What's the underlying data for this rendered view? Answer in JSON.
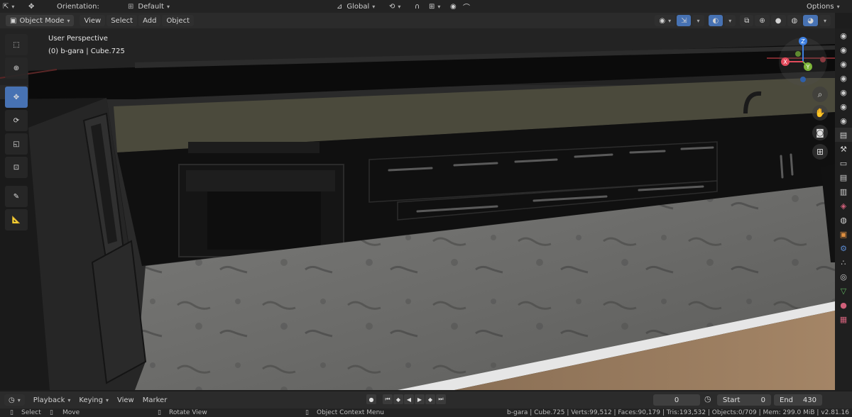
{
  "header": {
    "orientation_label": "Orientation:",
    "orientation_value": "Default",
    "transform_space": "Global",
    "options_label": "Options"
  },
  "viewport_header": {
    "mode": "Object Mode",
    "menus": [
      "View",
      "Select",
      "Add",
      "Object"
    ]
  },
  "viewport": {
    "perspective": "User Perspective",
    "active_object": "(0) b-gara | Cube.725"
  },
  "gizmo": {
    "axes": {
      "x": "X",
      "y": "Y",
      "z": "Z"
    },
    "colors": {
      "x": "#e24b5c",
      "y": "#7eb63a",
      "z": "#3d7fe0"
    }
  },
  "toolbar": {
    "tools": [
      "select-box",
      "cursor",
      "move",
      "rotate",
      "scale",
      "transform",
      "annotate",
      "measure"
    ],
    "active_tool": "move",
    "accent": "#4772b3"
  },
  "timeline": {
    "menus": [
      "Playback",
      "Keying",
      "View",
      "Marker"
    ],
    "current_frame": "0",
    "start_label": "Start",
    "start_value": "0",
    "end_label": "End",
    "end_value": "430"
  },
  "statusbar": {
    "select": "Select",
    "move": "Move",
    "rotate_view": "Rotate View",
    "context_menu": "Object Context Menu",
    "stats": "b-gara | Cube.725 | Verts:99,512 | Faces:90,179 | Tris:193,532 | Objects:0/709 | Mem: 299.0 MiB | v2.81.16"
  }
}
